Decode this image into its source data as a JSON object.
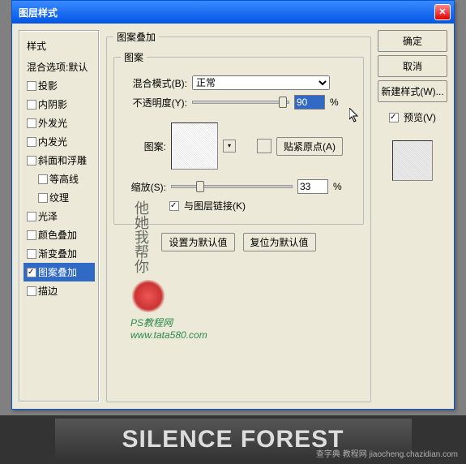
{
  "window": {
    "title": "图层样式"
  },
  "sidebar": {
    "header": "样式",
    "blending": "混合选项:默认",
    "items": [
      {
        "label": "投影",
        "checked": false
      },
      {
        "label": "内阴影",
        "checked": false
      },
      {
        "label": "外发光",
        "checked": false
      },
      {
        "label": "内发光",
        "checked": false
      },
      {
        "label": "斜面和浮雕",
        "checked": false
      },
      {
        "label": "等高线",
        "checked": false,
        "indent": true
      },
      {
        "label": "纹理",
        "checked": false,
        "indent": true
      },
      {
        "label": "光泽",
        "checked": false
      },
      {
        "label": "颜色叠加",
        "checked": false
      },
      {
        "label": "渐变叠加",
        "checked": false
      },
      {
        "label": "图案叠加",
        "checked": true,
        "selected": true
      },
      {
        "label": "描边",
        "checked": false
      }
    ]
  },
  "main": {
    "title": "图案叠加",
    "group": "图案",
    "blend_label": "混合模式(B):",
    "blend_value": "正常",
    "opacity_label": "不透明度(Y):",
    "opacity_value": "90",
    "opacity_suffix": "%",
    "pattern_label": "图案:",
    "snap_label": "贴紧原点(A)",
    "scale_label": "缩放(S):",
    "scale_value": "33",
    "scale_suffix": "%",
    "link_label": "与图层链接(K)",
    "reset_default": "设置为默认值",
    "restore_default": "复位为默认值"
  },
  "actions": {
    "ok": "确定",
    "cancel": "取消",
    "new_style": "新建样式(W)...",
    "preview": "预览(V)"
  },
  "watermark": {
    "line1": "PS教程网",
    "line2": "www.tata580.com"
  },
  "footer": {
    "text": "SILENCE FOREST",
    "wm": "查字典  教程网  jiaocheng.chazidian.com"
  }
}
